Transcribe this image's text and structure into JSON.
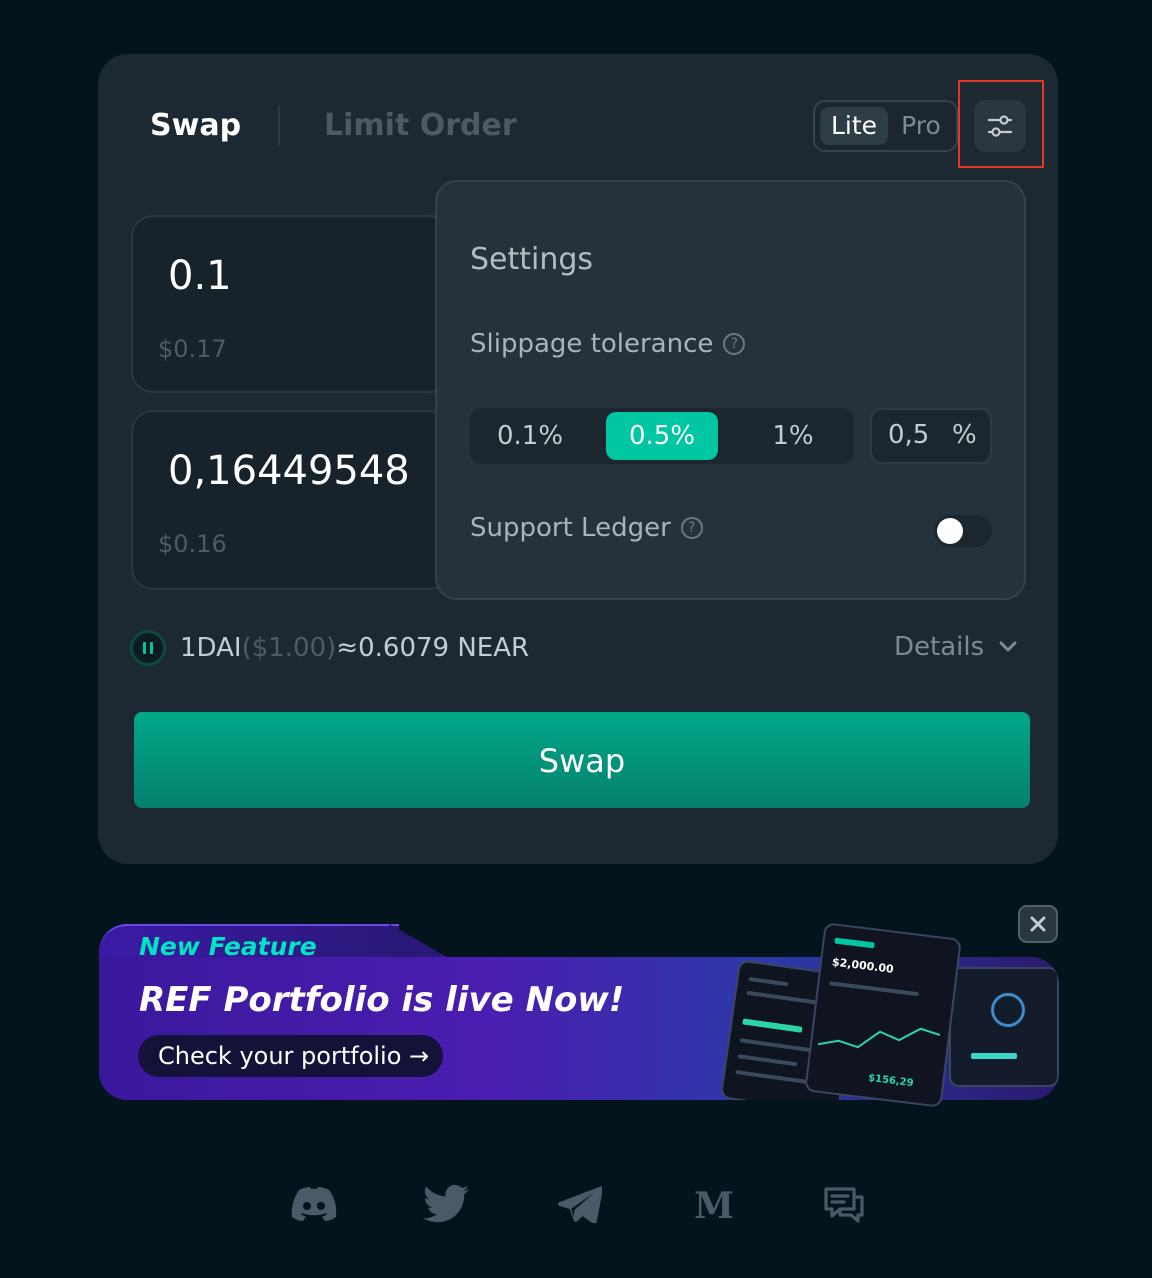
{
  "tabs": {
    "swap": "Swap",
    "limit_order": "Limit Order"
  },
  "mode": {
    "lite": "Lite",
    "pro": "Pro",
    "selected": "Lite"
  },
  "from": {
    "amount": "0.1",
    "usd": "$0.17"
  },
  "to": {
    "amount": "0,16449548",
    "usd": "$0.16"
  },
  "settings": {
    "title": "Settings",
    "slippage_label": "Slippage tolerance",
    "slippage_options": [
      "0.1%",
      "0.5%",
      "1%"
    ],
    "slippage_selected": "0.5%",
    "slippage_input_value": "0,5",
    "slippage_input_unit": "%",
    "ledger_label": "Support Ledger",
    "ledger_enabled": false,
    "help_glyph": "?"
  },
  "rate": {
    "lhs": "1DAI",
    "lhs_usd": "($1.00)",
    "approx": "≈",
    "rhs": "0.6079 NEAR"
  },
  "details_label": "Details",
  "swap_button_label": "Swap",
  "banner": {
    "tag": "New Feature",
    "headline": "REF Portfolio is live Now!",
    "cta": "Check your portfolio →",
    "phone_balance": "$2,000.00",
    "phone_value": "$156,29"
  },
  "socials": [
    "discord-icon",
    "twitter-icon",
    "telegram-icon",
    "medium-icon",
    "forum-icon"
  ],
  "colors": {
    "background": "#03141c",
    "card": "#1d2932",
    "accent": "#00c6a2",
    "highlight_box": "#e03a24"
  }
}
